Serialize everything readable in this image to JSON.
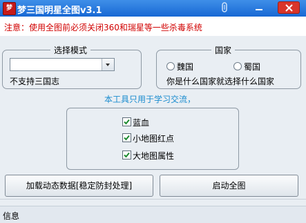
{
  "window": {
    "title": "梦三国明星全图v3.1",
    "app_icon_text": "梦",
    "title_gradient": [
      "#3f8fe8",
      "#1768d4"
    ]
  },
  "notice": {
    "text": "注意：使用全图前必须关闭360和瑞星等一些杀毒系统",
    "color": "#d10000"
  },
  "mode_group": {
    "title": "选择模式",
    "selected_value": "",
    "note": "不支持三国志"
  },
  "country_group": {
    "title": "国家",
    "options": [
      {
        "label": "魏国",
        "checked": false
      },
      {
        "label": "蜀国",
        "checked": false
      }
    ],
    "note": "你是什么国家就选择什么国家"
  },
  "study_note": {
    "text": "本工具只用于学习交流，",
    "color": "#1a8ccf"
  },
  "features": [
    {
      "label": "蓝血",
      "checked": true
    },
    {
      "label": "小地图红点",
      "checked": true
    },
    {
      "label": "大地图属性",
      "checked": true
    }
  ],
  "buttons": {
    "load": "加载动态数据[稳定防封处理]",
    "start": "启动全图"
  },
  "status": {
    "text": "信息"
  }
}
